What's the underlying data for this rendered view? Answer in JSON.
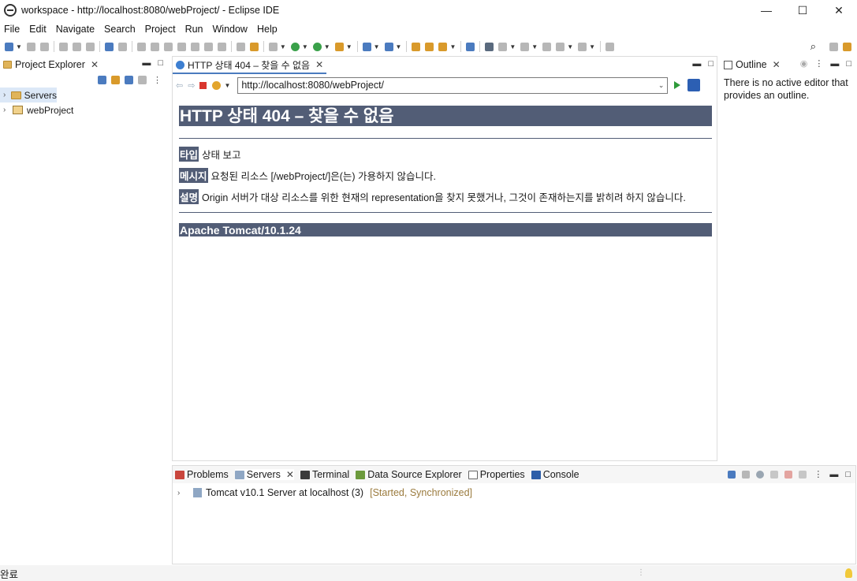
{
  "window": {
    "title": "workspace - http://localhost:8080/webProject/ - Eclipse IDE",
    "minimize": "—",
    "maximize": "☐",
    "close": "✕"
  },
  "menu": [
    "File",
    "Edit",
    "Navigate",
    "Search",
    "Project",
    "Run",
    "Window",
    "Help"
  ],
  "project_explorer": {
    "tab_label": "Project Explorer",
    "items": [
      {
        "label": "Servers"
      },
      {
        "label": "webProject"
      }
    ]
  },
  "editor": {
    "tab_label": "HTTP 상태 404 – 찾을 수 없음",
    "url": "http://localhost:8080/webProject/",
    "page": {
      "title": "HTTP 상태 404 – 찾을 수 없음",
      "type_label": "타입",
      "type_value": "상태 보고",
      "message_label": "메시지",
      "message_value": "요청된 리소스 [/webProject/]은(는) 가용하지 않습니다.",
      "desc_label": "설명",
      "desc_value": "Origin 서버가 대상 리소스를 위한 현재의 representation을 찾지 못했거나, 그것이 존재하는지를 밝히려 하지 않습니다.",
      "footer": "Apache Tomcat/10.1.24"
    }
  },
  "outline": {
    "tab_label": "Outline",
    "message": "There is no active editor that provides an outline."
  },
  "bottom": {
    "tabs": [
      "Problems",
      "Servers",
      "Terminal",
      "Data Source Explorer",
      "Properties",
      "Console"
    ],
    "server": {
      "name": "Tomcat v10.1 Server at localhost (3)",
      "state": "[Started, Synchronized]"
    }
  },
  "status": {
    "text": "완료"
  }
}
